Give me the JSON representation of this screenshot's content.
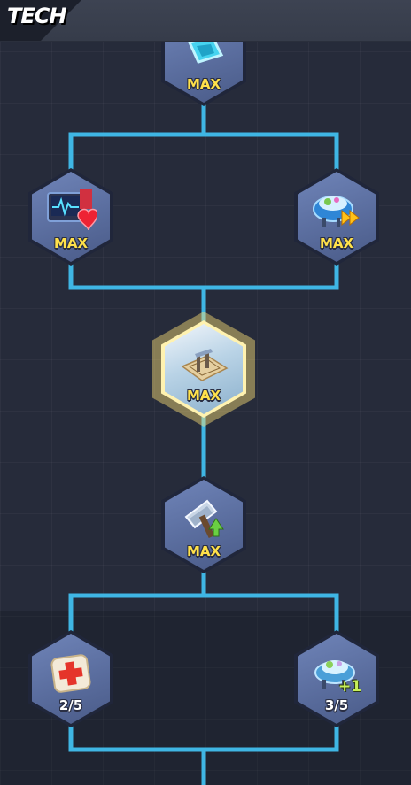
{
  "header": {
    "title": "TECH"
  },
  "nodes": [
    {
      "icon": "glass-cube-icon",
      "level": "MAX"
    },
    {
      "icon": "heart-monitor-icon",
      "level": "MAX"
    },
    {
      "icon": "speed-drill-icon",
      "level": "MAX"
    },
    {
      "icon": "blueprint-icon",
      "level": "MAX",
      "selected": true
    },
    {
      "icon": "hammer-upgrade-icon",
      "level": "MAX"
    },
    {
      "icon": "first-aid-kit-icon",
      "level": "2/5"
    },
    {
      "icon": "drill-plus-one-icon",
      "level": "3/5",
      "badge": "+1"
    }
  ],
  "colors": {
    "background": "#262b3a",
    "connector": "#3fb6e4",
    "max_label": "#ffe14a",
    "hex_fill": "#5f72a5",
    "selected_glow": "#fff2b0"
  }
}
